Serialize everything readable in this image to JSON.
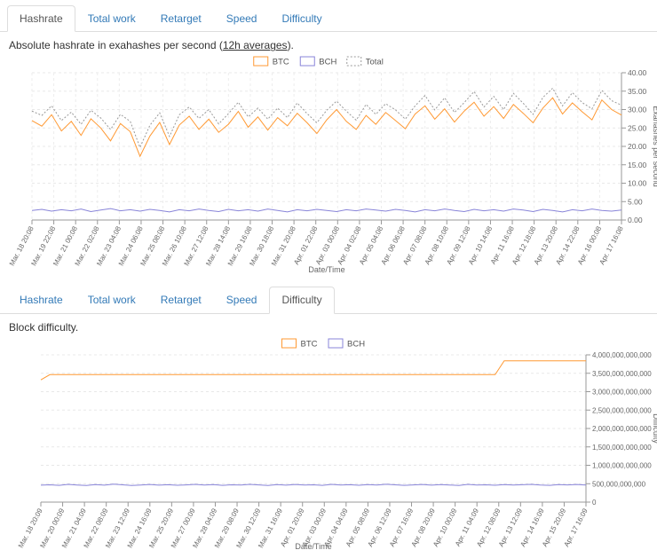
{
  "colors": {
    "tab_link": "#337ab7",
    "active_tab_text": "#555555",
    "btc": "#ff9933",
    "bch": "#8884d8",
    "total": "#999999"
  },
  "panels": [
    {
      "tabs": [
        "Hashrate",
        "Total work",
        "Retarget",
        "Speed",
        "Difficulty"
      ],
      "active_tab": "Hashrate",
      "description": {
        "prefix": "Absolute hashrate in exahashes per second (",
        "link_text": "12h averages",
        "suffix": ")."
      }
    },
    {
      "tabs": [
        "Hashrate",
        "Total work",
        "Retarget",
        "Speed",
        "Difficulty"
      ],
      "active_tab": "Difficulty",
      "description": {
        "prefix": "Block difficulty.",
        "link_text": "",
        "suffix": ""
      }
    }
  ],
  "chart_data": [
    {
      "type": "line",
      "name": "hashrate",
      "title": "Absolute hashrate in exahashes per second (12h averages)",
      "xlabel": "Date/Time",
      "ylabel": "Exahashes per second",
      "ylim": [
        0,
        40
      ],
      "grid": true,
      "legend_position": "top",
      "legend": [
        "BTC",
        "BCH",
        "Total"
      ],
      "y_tick_labels": [
        "0.00",
        "5.00",
        "10.00",
        "15.00",
        "20.00",
        "25.00",
        "30.00",
        "35.00",
        "40.00"
      ],
      "x_tick_labels": [
        "Mar. 18 20:08",
        "Mar. 19 22:08",
        "Mar. 21 00:08",
        "Mar. 22 02:08",
        "Mar. 23 04:08",
        "Mar. 24 06:08",
        "Mar. 25 08:08",
        "Mar. 26 10:08",
        "Mar. 27 12:08",
        "Mar. 28 14:08",
        "Mar. 29 16:08",
        "Mar. 30 18:08",
        "Mar. 31 20:08",
        "Apr. 01 22:08",
        "Apr. 03 00:08",
        "Apr. 04 02:08",
        "Apr. 05 04:08",
        "Apr. 06 06:08",
        "Apr. 07 08:08",
        "Apr. 08 10:08",
        "Apr. 09 12:08",
        "Apr. 10 14:08",
        "Apr. 11 16:08",
        "Apr. 12 18:08",
        "Apr. 13 20:08",
        "Apr. 14 22:08",
        "Apr. 16 00:08",
        "Apr. 17 16:08"
      ],
      "series": [
        {
          "name": "BTC",
          "color": "#ff9933",
          "dash": "",
          "values": [
            27.0,
            25.5,
            28.6,
            24.2,
            26.8,
            23.0,
            27.5,
            25.0,
            21.5,
            26.2,
            24.0,
            17.3,
            22.8,
            26.5,
            20.5,
            25.8,
            28.2,
            24.6,
            27.4,
            23.8,
            26.0,
            29.5,
            25.2,
            28.0,
            24.4,
            27.8,
            25.6,
            29.0,
            26.4,
            23.5,
            27.2,
            30.0,
            26.8,
            24.6,
            28.4,
            26.0,
            29.2,
            27.0,
            24.8,
            28.8,
            31.0,
            27.4,
            30.2,
            26.6,
            29.6,
            32.0,
            28.2,
            30.8,
            27.6,
            31.4,
            29.0,
            26.4,
            30.4,
            33.2,
            28.8,
            31.8,
            29.4,
            27.2,
            32.6,
            30.0,
            28.5
          ]
        },
        {
          "name": "BCH",
          "color": "#8884d8",
          "dash": "",
          "values": [
            2.6,
            2.9,
            2.4,
            2.8,
            2.5,
            3.0,
            2.3,
            2.7,
            3.1,
            2.5,
            2.8,
            2.4,
            2.9,
            2.6,
            2.2,
            2.8,
            2.5,
            3.0,
            2.6,
            2.3,
            2.9,
            2.5,
            2.8,
            2.4,
            3.0,
            2.6,
            2.2,
            2.8,
            2.5,
            2.9,
            2.6,
            2.3,
            2.8,
            2.5,
            3.0,
            2.7,
            2.4,
            2.9,
            2.6,
            2.2,
            2.8,
            2.5,
            3.0,
            2.6,
            2.3,
            2.9,
            2.5,
            2.8,
            2.4,
            3.0,
            2.7,
            2.3,
            2.9,
            2.6,
            2.2,
            2.8,
            2.5,
            3.0,
            2.6,
            2.4,
            2.7
          ]
        },
        {
          "name": "Total",
          "color": "#999999",
          "dash": "2 2",
          "values": [
            29.6,
            28.4,
            31.0,
            27.0,
            29.3,
            26.0,
            29.8,
            27.7,
            24.6,
            28.7,
            26.8,
            19.7,
            25.7,
            29.1,
            22.7,
            28.6,
            30.7,
            27.6,
            30.0,
            26.1,
            28.9,
            32.0,
            28.0,
            30.4,
            27.4,
            30.4,
            27.8,
            31.8,
            28.9,
            26.4,
            29.8,
            32.3,
            29.6,
            27.1,
            31.4,
            28.7,
            31.6,
            29.9,
            27.4,
            31.0,
            33.8,
            29.9,
            33.2,
            29.2,
            31.9,
            34.9,
            30.7,
            33.6,
            30.0,
            34.4,
            31.7,
            28.7,
            33.3,
            35.8,
            31.0,
            34.6,
            31.9,
            30.2,
            35.2,
            32.4,
            31.2
          ]
        }
      ]
    },
    {
      "type": "line",
      "name": "difficulty",
      "title": "Block difficulty",
      "xlabel": "Date/Time",
      "ylabel": "Difficulty",
      "ylim": [
        0,
        4000000000000
      ],
      "grid": true,
      "legend_position": "top",
      "legend": [
        "BTC",
        "BCH"
      ],
      "y_tick_labels": [
        "0",
        "500,000,000,000",
        "1,000,000,000,000",
        "1,500,000,000,000",
        "2,000,000,000,000",
        "2,500,000,000,000",
        "3,000,000,000,000",
        "3,500,000,000,000",
        "4,000,000,000,000"
      ],
      "x_tick_labels": [
        "Mar. 18 20:09",
        "Mar. 20 00:09",
        "Mar. 21 04:09",
        "Mar. 22 08:09",
        "Mar. 23 12:09",
        "Mar. 24 16:09",
        "Mar. 25 20:09",
        "Mar. 27 00:09",
        "Mar. 28 04:09",
        "Mar. 29 08:09",
        "Mar. 30 12:09",
        "Mar. 31 16:09",
        "Apr. 01 20:09",
        "Apr. 03 00:09",
        "Apr. 04 04:09",
        "Apr. 05 08:09",
        "Apr. 06 12:09",
        "Apr. 07 16:09",
        "Apr. 08 20:09",
        "Apr. 10 00:09",
        "Apr. 11 04:09",
        "Apr. 12 08:09",
        "Apr. 13 12:09",
        "Apr. 14 16:09",
        "Apr. 15 20:09",
        "Apr. 17 16:09"
      ],
      "series": [
        {
          "name": "BTC",
          "color": "#ff9933",
          "dash": "",
          "values": [
            3320000000000.0,
            3462000000000.0,
            3462000000000.0,
            3462000000000.0,
            3462000000000.0,
            3462000000000.0,
            3462000000000.0,
            3462000000000.0,
            3462000000000.0,
            3462000000000.0,
            3462000000000.0,
            3462000000000.0,
            3462000000000.0,
            3462000000000.0,
            3462000000000.0,
            3462000000000.0,
            3462000000000.0,
            3462000000000.0,
            3462000000000.0,
            3462000000000.0,
            3462000000000.0,
            3462000000000.0,
            3462000000000.0,
            3462000000000.0,
            3462000000000.0,
            3462000000000.0,
            3462000000000.0,
            3462000000000.0,
            3462000000000.0,
            3462000000000.0,
            3462000000000.0,
            3462000000000.0,
            3462000000000.0,
            3462000000000.0,
            3462000000000.0,
            3462000000000.0,
            3462000000000.0,
            3462000000000.0,
            3462000000000.0,
            3462000000000.0,
            3462000000000.0,
            3462000000000.0,
            3462000000000.0,
            3462000000000.0,
            3462000000000.0,
            3462000000000.0,
            3462000000000.0,
            3462000000000.0,
            3462000000000.0,
            3462000000000.0,
            3462000000000.0,
            3839000000000.0,
            3839000000000.0,
            3839000000000.0,
            3839000000000.0,
            3839000000000.0,
            3839000000000.0,
            3839000000000.0,
            3839000000000.0,
            3839000000000.0,
            3839000000000.0
          ]
        },
        {
          "name": "BCH",
          "color": "#8884d8",
          "dash": "",
          "values": [
            460000000000.0,
            471000000000.0,
            455000000000.0,
            482000000000.0,
            466000000000.0,
            450000000000.0,
            476000000000.0,
            461000000000.0,
            486000000000.0,
            470000000000.0,
            454000000000.0,
            465000000000.0,
            479000000000.0,
            460000000000.0,
            473000000000.0,
            457000000000.0,
            468000000000.0,
            481000000000.0,
            462000000000.0,
            476000000000.0,
            455000000000.0,
            470000000000.0,
            464000000000.0,
            483000000000.0,
            468000000000.0,
            452000000000.0,
            475000000000.0,
            460000000000.0,
            479000000000.0,
            465000000000.0,
            471000000000.0,
            456000000000.0,
            481000000000.0,
            466000000000.0,
            473000000000.0,
            458000000000.0,
            477000000000.0,
            462000000000.0,
            485000000000.0,
            470000000000.0,
            455000000000.0,
            468000000000.0,
            479000000000.0,
            460000000000.0,
            475000000000.0,
            466000000000.0,
            452000000000.0,
            481000000000.0,
            465000000000.0,
            471000000000.0,
            458000000000.0,
            477000000000.0,
            462000000000.0,
            473000000000.0,
            481000000000.0,
            466000000000.0,
            455000000000.0,
            475000000000.0,
            468000000000.0,
            479000000000.0,
            465000000000.0
          ]
        }
      ]
    }
  ]
}
